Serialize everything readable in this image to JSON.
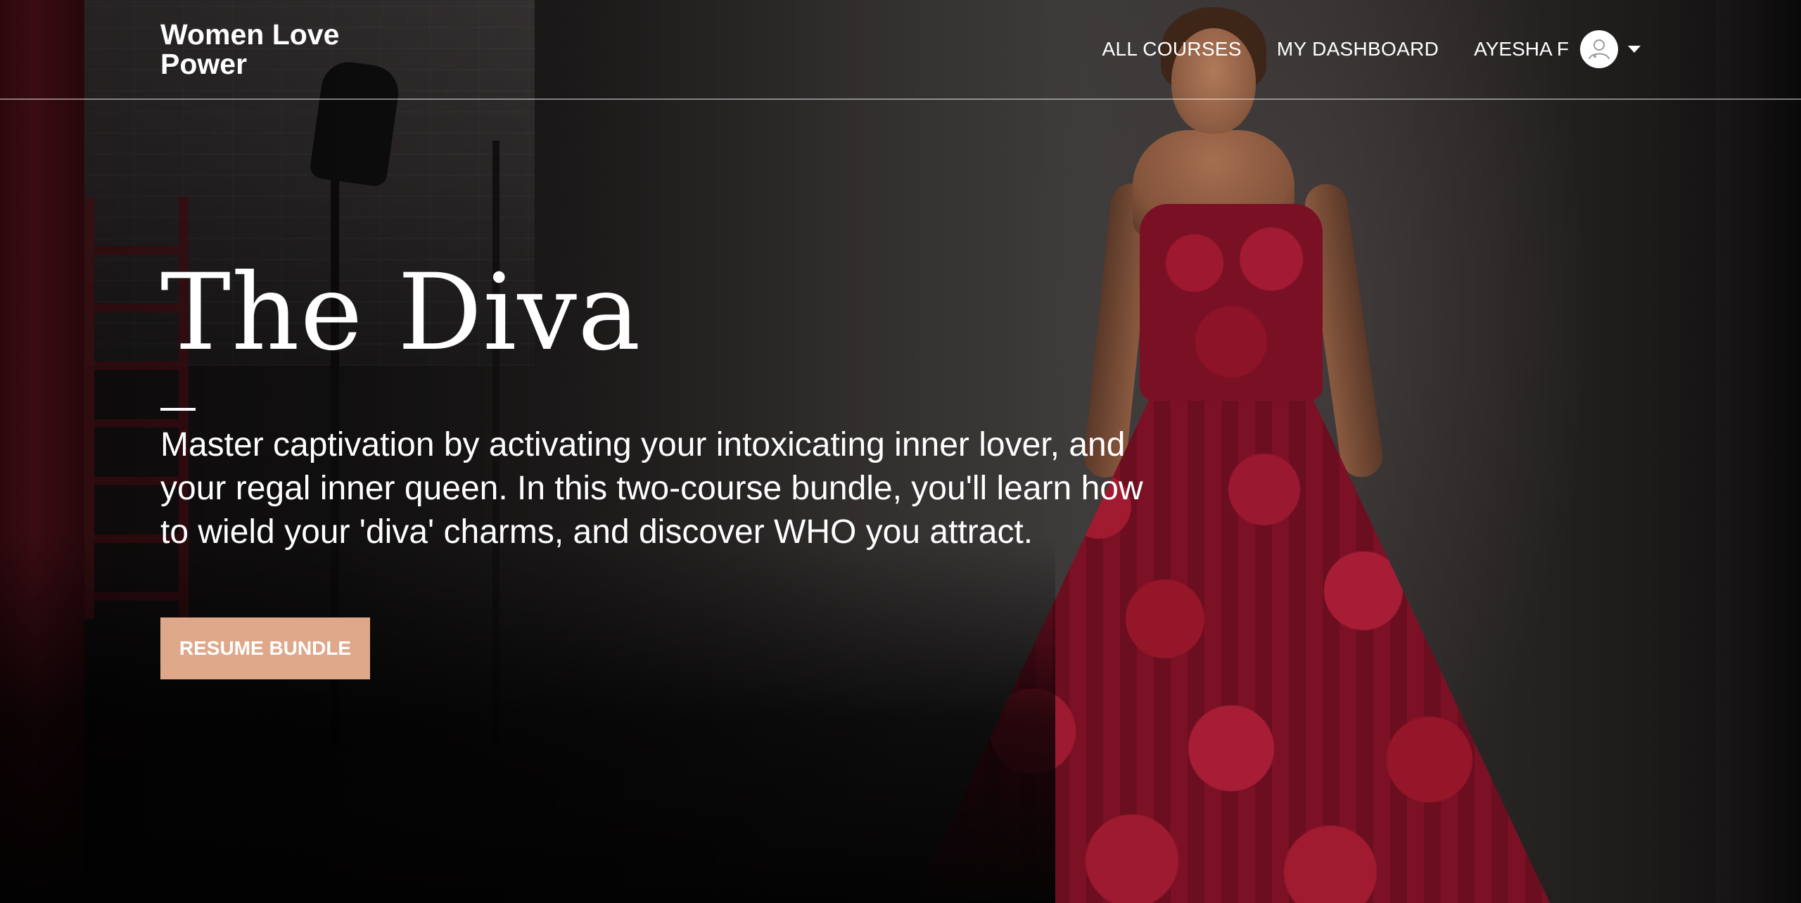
{
  "header": {
    "brand_line1": "Women Love",
    "brand_line2": "Power",
    "nav": {
      "all_courses": "ALL COURSES",
      "my_dashboard": "MY DASHBOARD"
    },
    "user": {
      "name": "AYESHA F",
      "avatar_icon": "user-avatar-icon",
      "menu_icon": "caret-down-icon"
    }
  },
  "hero": {
    "title": "The Diva",
    "description": "Master captivation by activating your intoxicating inner lover, and your regal inner queen. In this two-course bundle, you'll learn how to wield your 'diva' charms, and discover WHO you attract.",
    "button_label": "RESUME BUNDLE",
    "button_color": "#e0a88a"
  }
}
